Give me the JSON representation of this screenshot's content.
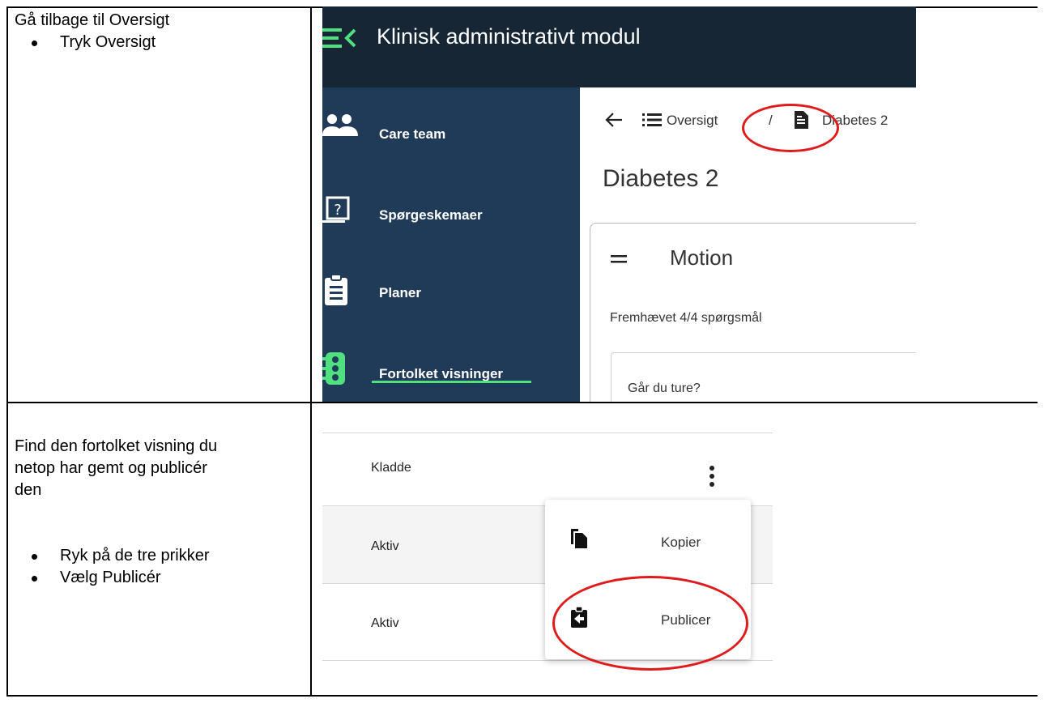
{
  "row1": {
    "title": "Gå tilbage til Oversigt",
    "bullets": [
      "Tryk Oversigt"
    ]
  },
  "row2": {
    "title_lines": [
      "Find den fortolket visning du",
      "netop har gemt og publicér",
      "den"
    ],
    "bullets": [
      "Ryk på de tre prikker",
      "Vælg Publicér"
    ]
  },
  "screenshot1": {
    "app_title": "Klinisk administrativt modul",
    "nav": [
      {
        "label": "Care team",
        "icon": "people-icon"
      },
      {
        "label": "Spørgeskemaer",
        "icon": "question-icon"
      },
      {
        "label": "Planer",
        "icon": "clipboard-icon"
      },
      {
        "label": "Fortolket visninger",
        "icon": "traffic-light-icon"
      }
    ],
    "breadcrumb": {
      "overview": "Oversigt",
      "separator": "/",
      "current": "Diabetes 2"
    },
    "heading": "Diabetes 2",
    "card": {
      "title": "Motion",
      "subtitle": "Fremhævet 4/4 spørgsmål",
      "question": "Går du ture?"
    },
    "colors": {
      "topbar": "#172635",
      "sidebar": "#1f3b58",
      "accent": "#50e080",
      "highlight": "#e01b1b"
    }
  },
  "screenshot2": {
    "rows": [
      "Kladde",
      "Aktiv",
      "Aktiv"
    ],
    "menu": [
      {
        "label": "Kopier",
        "icon": "copy-icon"
      },
      {
        "label": "Publicer",
        "icon": "publish-clipboard-icon"
      }
    ]
  }
}
